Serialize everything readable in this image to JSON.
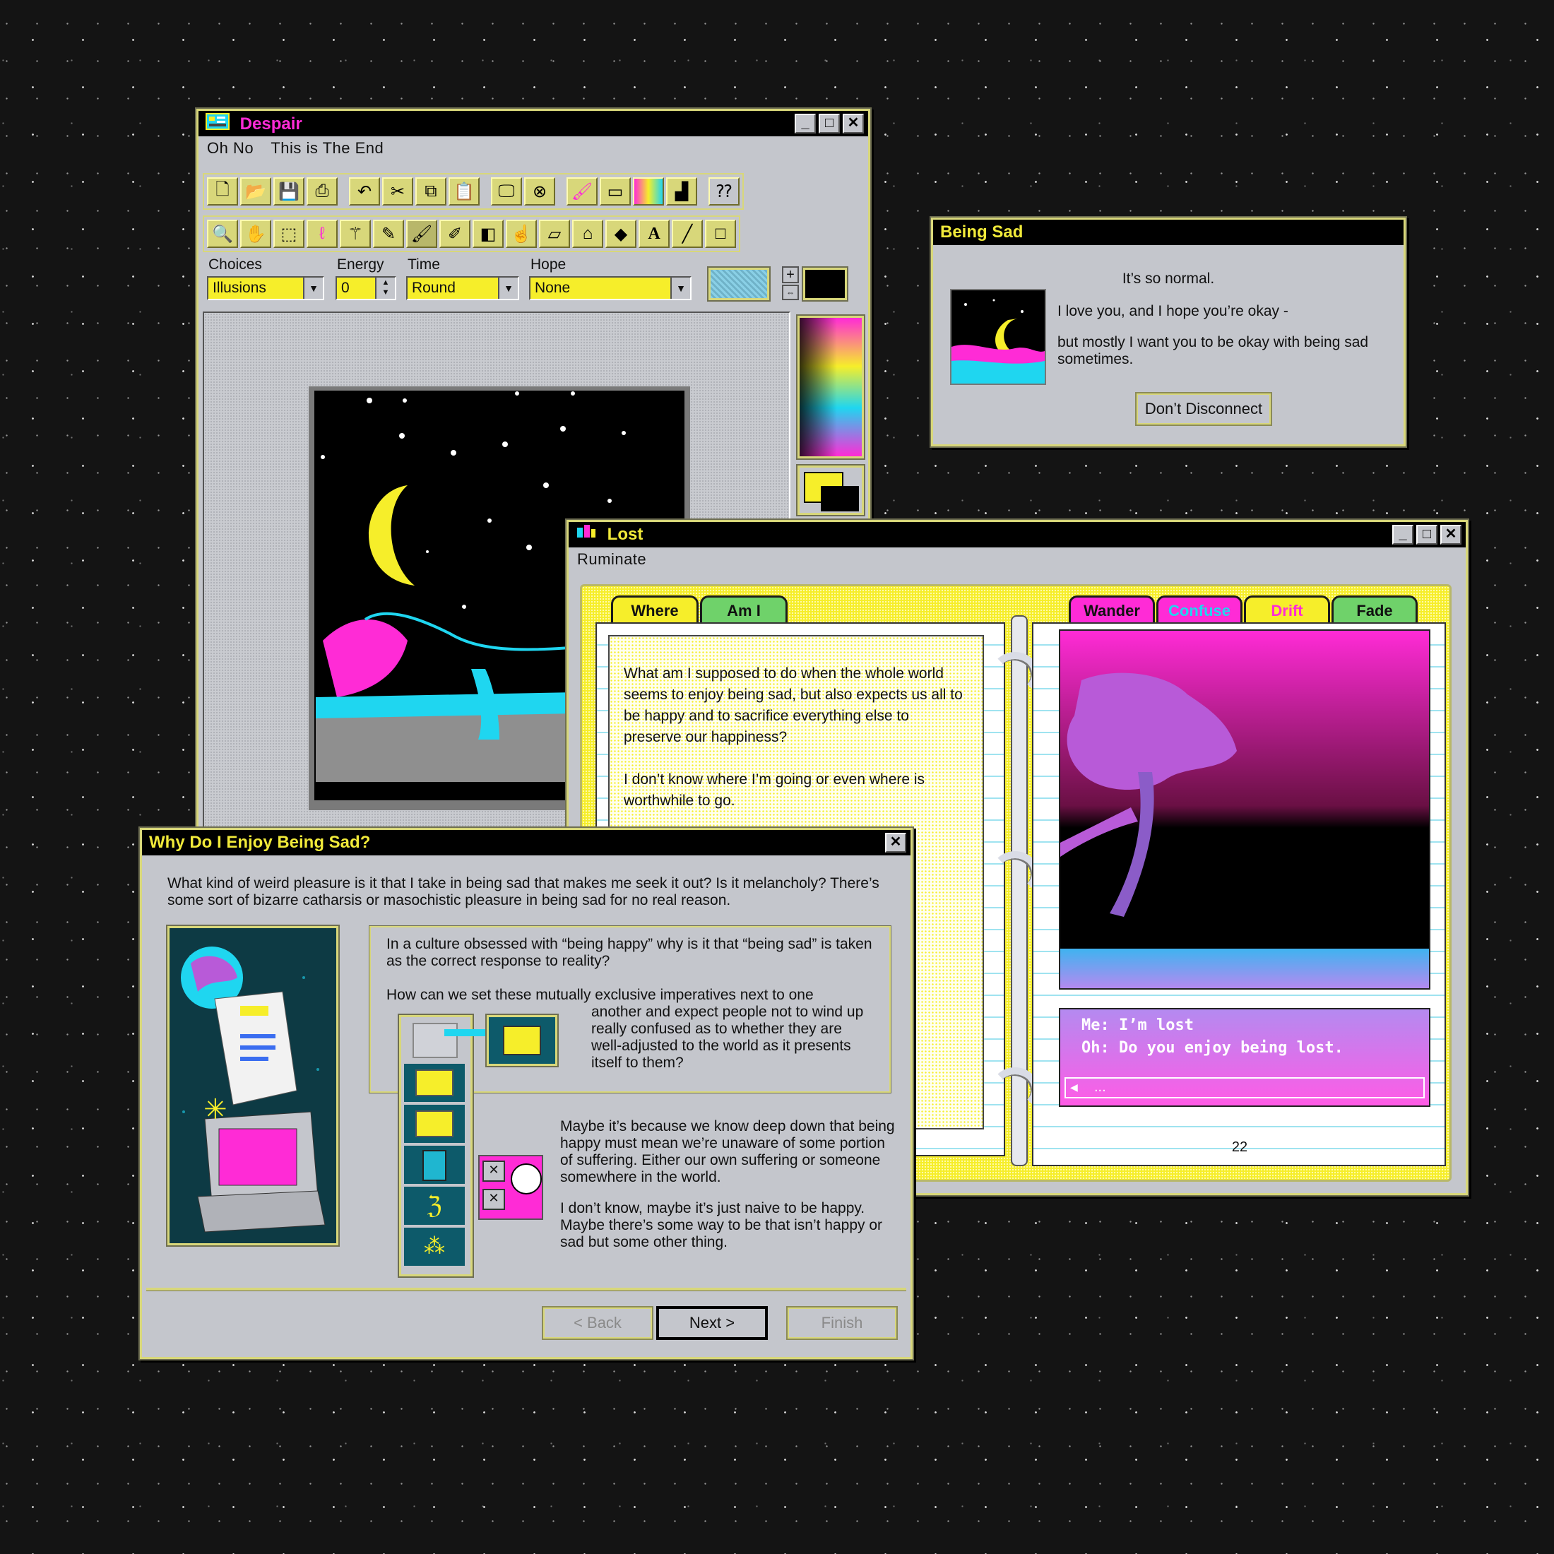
{
  "despair": {
    "title": "Despair",
    "menu": [
      "Oh No",
      "This is The End"
    ],
    "fields": {
      "choices_label": "Choices",
      "choices_value": "Illusions",
      "energy_label": "Energy",
      "energy_value": "0",
      "time_label": "Time",
      "time_value": "Round",
      "hope_label": "Hope",
      "hope_value": "None"
    },
    "toolbar1_icons": [
      "new-file-icon",
      "open-folder-icon",
      "save-icon",
      "print-icon",
      "undo-icon",
      "cut-icon",
      "copy-icon",
      "paste-icon",
      "monitor-icon",
      "cancel-icon",
      "brush-icon",
      "film-icon",
      "color-bars-icon",
      "chart-icon",
      "help-icon"
    ],
    "toolbar2_icons": [
      "zoom-icon",
      "hand-icon",
      "rect-select-icon",
      "lasso-icon",
      "magic-wand-icon",
      "pencil-icon",
      "brush-icon",
      "airbrush-icon",
      "fill-icon",
      "smudge-icon",
      "eraser-icon",
      "stamp-icon",
      "diamond-icon",
      "text-icon",
      "line-icon",
      "rectangle-icon"
    ],
    "text_tool": "A"
  },
  "being_sad": {
    "title": "Being Sad",
    "line1": "It’s so normal.",
    "line2": "I love you, and I hope you’re okay -",
    "line3": "but mostly I want you to be okay with being sad sometimes.",
    "button": "Don’t Disconnect"
  },
  "lost": {
    "title": "Lost",
    "menu": "Ruminate",
    "left_tabs": [
      "Where",
      "Am I"
    ],
    "right_tabs": [
      "Wander",
      "Confuse",
      "Drift",
      "Fade"
    ],
    "paragraph1": "What am I supposed to do when the whole world seems to enjoy being sad, but also expects us all to be happy and to sacrifice everything else to preserve our happiness?",
    "paragraph2": "I don’t know where I’m going or even where is worthwhile to go.",
    "chat_line1": "Me: I’m lost",
    "chat_line2": "Oh: Do you enjoy being lost.",
    "chat_input": "...",
    "page_number": "22"
  },
  "why": {
    "title": "Why Do I Enjoy Being Sad?",
    "intro": "What kind of weird pleasure is it that I take in being sad that makes me seek it out? Is it melancholy? There’s some sort of bizarre catharsis or masochistic pleasure in being sad for no real reason.",
    "box_p1": "In a culture obsessed with “being happy” why is it that “being sad” is taken as the correct response to reality?",
    "box_p2_a": "How can we set these mutually exclusive imperatives next to one",
    "box_p2_b": "another and expect people not to wind up really confused as to whether they are well-adjusted to the world as it presents itself to them?",
    "p3": "Maybe it’s because we know deep down that being happy must mean we’re unaware of some portion of suffering. Either our own suffering or someone somewhere in the world.",
    "p4": "I don’t know, maybe it’s just naive to be happy. Maybe there’s some way to be that isn’t happy or sad but some other thing.",
    "back": "< Back",
    "next": "Next >",
    "finish": "Finish"
  },
  "colors": {
    "accent_yellow": "#f6ee2a",
    "magenta": "#ff2bd6",
    "cyan": "#1fd6f0",
    "window_gray": "#c4c6cc",
    "frame_khaki": "#d8d77a"
  }
}
